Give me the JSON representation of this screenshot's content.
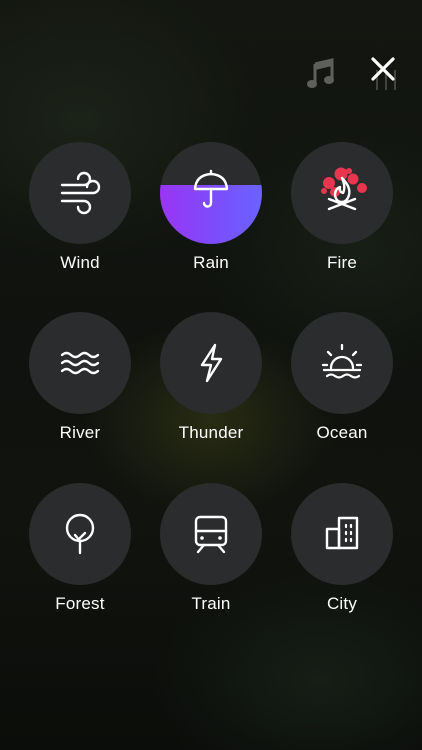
{
  "header": {
    "music_icon": "music-note-icon",
    "close_icon": "close-icon",
    "mixer_icon": "mixer-icon"
  },
  "colors": {
    "circle": "#2b2c2d",
    "active_gradient_start": "#9a35f5",
    "active_gradient_end": "#6a63ff",
    "fire_accent": "#e8364f"
  },
  "sounds": [
    {
      "label": "Wind",
      "icon": "wind-icon",
      "active": false,
      "volume": 0
    },
    {
      "label": "Rain",
      "icon": "umbrella-icon",
      "active": true,
      "volume": 0.58
    },
    {
      "label": "Fire",
      "icon": "campfire-icon",
      "active": false,
      "volume": 0
    },
    {
      "label": "River",
      "icon": "waves-icon",
      "active": false,
      "volume": 0
    },
    {
      "label": "Thunder",
      "icon": "lightning-icon",
      "active": false,
      "volume": 0
    },
    {
      "label": "Ocean",
      "icon": "sunset-icon",
      "active": false,
      "volume": 0
    },
    {
      "label": "Forest",
      "icon": "tree-icon",
      "active": false,
      "volume": 0
    },
    {
      "label": "Train",
      "icon": "train-icon",
      "active": false,
      "volume": 0
    },
    {
      "label": "City",
      "icon": "buildings-icon",
      "active": false,
      "volume": 0
    }
  ]
}
